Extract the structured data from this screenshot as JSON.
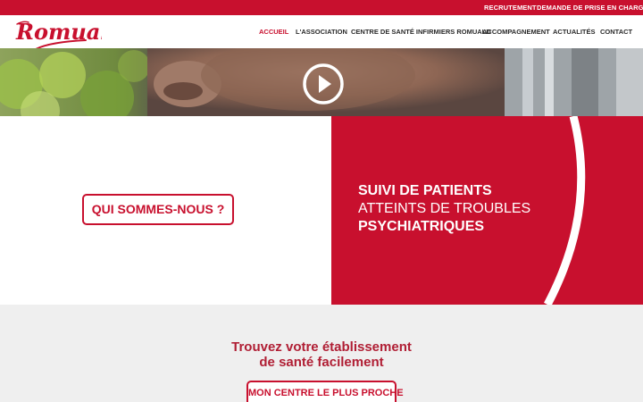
{
  "topbar": {
    "links": [
      {
        "label": "RECRUTEMENT"
      },
      {
        "label": "DEMANDE DE PRISE EN CHARGE"
      }
    ]
  },
  "header": {
    "logo_text": "Romuald",
    "nav": [
      {
        "label": "ACCUEIL",
        "active": true
      },
      {
        "label": "L'ASSOCIATION",
        "active": false
      },
      {
        "label": "CENTRE DE SANTÉ INFIRMIERS ROMUALD",
        "active": false
      },
      {
        "label": "ACCOMPAGNEMENT",
        "active": false
      },
      {
        "label": "ACTUALITÉS",
        "active": false
      },
      {
        "label": "CONTACT",
        "active": false
      }
    ]
  },
  "hero": {
    "play_icon": "play-circle-icon"
  },
  "about": {
    "button_label": "QUI SOMMES-NOUS ?"
  },
  "tagline": {
    "line1": "SUIVI DE PATIENTS",
    "line2": "ATTEINTS DE TROUBLES",
    "line3": "PSYCHIATRIQUES"
  },
  "find": {
    "title_line1": "Trouvez votre établissement",
    "title_line2": "de santé facilement",
    "button_label": "MON CENTRE LE PLUS PROCHE"
  },
  "colors": {
    "brand_red": "#c8102e",
    "title_red": "#b01e34",
    "grey_bg": "#efefef",
    "nav_text": "#2a2a2a"
  }
}
